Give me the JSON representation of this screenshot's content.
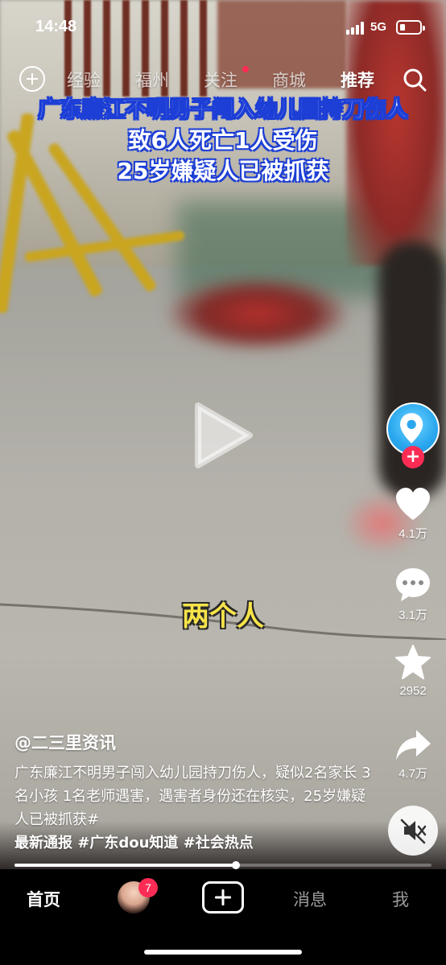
{
  "status_bar": {
    "time": "14:48",
    "network": "5G"
  },
  "top_nav": {
    "tabs": [
      {
        "label": "经验"
      },
      {
        "label": "福州"
      },
      {
        "label": "关注"
      },
      {
        "label": "商城"
      },
      {
        "label": "推荐"
      }
    ],
    "active_tab": "推荐"
  },
  "video": {
    "headline_lines": [
      "广东廉江不明男子闯入幼儿园持刀伤人",
      "致6人死亡1人受伤",
      "25岁嫌疑人已被抓获"
    ],
    "subtitle": "两个人",
    "progress": 0.53
  },
  "actions": {
    "likes": "4.1万",
    "comments": "3.1万",
    "favorites": "2952",
    "shares": "4.7万"
  },
  "caption": {
    "author": "@二三里资讯",
    "text": "广东廉江不明男子闯入幼儿园持刀伤人，疑似2名家长 3名小孩 1名老师遇害，遇害者身份还在核实，25岁嫌疑人已被抓获#",
    "tags": "最新通报 #广东dou知道 #社会热点"
  },
  "tab_bar": {
    "home": "首页",
    "friends_badge": "7",
    "messages": "消息",
    "me": "我"
  },
  "colors": {
    "accent": "#fe2c55",
    "headline_outline": "#1d3fd6",
    "subtitle": "#f7e44a"
  }
}
